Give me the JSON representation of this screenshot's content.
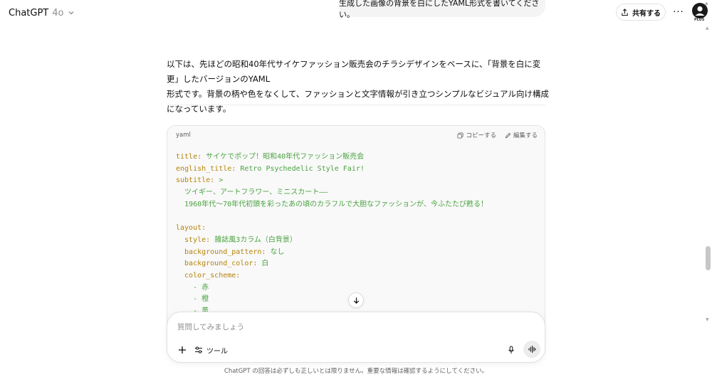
{
  "header": {
    "model_name": "ChatGPT",
    "model_version": "4o",
    "share_label": "共有する",
    "more_label": "···",
    "avatar_badge": "PLUS"
  },
  "user_message": "生成した画像の背景を白にしたYAML形式を書いてください。",
  "assistant": {
    "paragraph_line1": "以下は、先ほどの昭和40年代サイケファッション販売会のチラシデザインをベースに、「背景を白に変更」したバージョンのYAML",
    "paragraph_line2": "形式です。背景の柄や色をなくして、ファッションと文字情報が引き立つシンプルなビジュアル向け構成になっています。"
  },
  "code_block": {
    "language": "yaml",
    "copy_label": "コピーする",
    "edit_label": "編集する",
    "lines": [
      {
        "key": "title:",
        "value": " サイケでポップ！昭和40年代ファッション販売会"
      },
      {
        "key": "english_title:",
        "value": " Retro Psychedelic Style Fair!"
      },
      {
        "key": "subtitle:",
        "value": " >"
      },
      {
        "key": "",
        "value": "  ツイギー、アートフラワー、ミニスカート――"
      },
      {
        "key": "",
        "value": "  1960年代〜70年代初頭を彩ったあの頃のカラフルで大胆なファッションが、今ふたたび甦る！"
      },
      {
        "key": "",
        "value": ""
      },
      {
        "key": "layout:",
        "value": ""
      },
      {
        "key": "  style:",
        "value": " 雑誌風3カラム（白背景）"
      },
      {
        "key": "  background_pattern:",
        "value": " なし"
      },
      {
        "key": "  background_color:",
        "value": " 白"
      },
      {
        "key": "  color_scheme:",
        "value": ""
      },
      {
        "key": "",
        "value": "    - 赤"
      },
      {
        "key": "",
        "value": "    - 橙"
      },
      {
        "key": "",
        "value": "    - 黄"
      }
    ]
  },
  "composer": {
    "placeholder": "質問してみましょう",
    "tools_label": "ツール"
  },
  "disclaimer": "ChatGPT の回答は必ずしも正しいとは限りません。重要な情報は確認するようにしてください。",
  "colors": {
    "yaml_key": "#b5830a",
    "yaml_value": "#4aa341",
    "bubble_bg": "#f4f4f4"
  }
}
